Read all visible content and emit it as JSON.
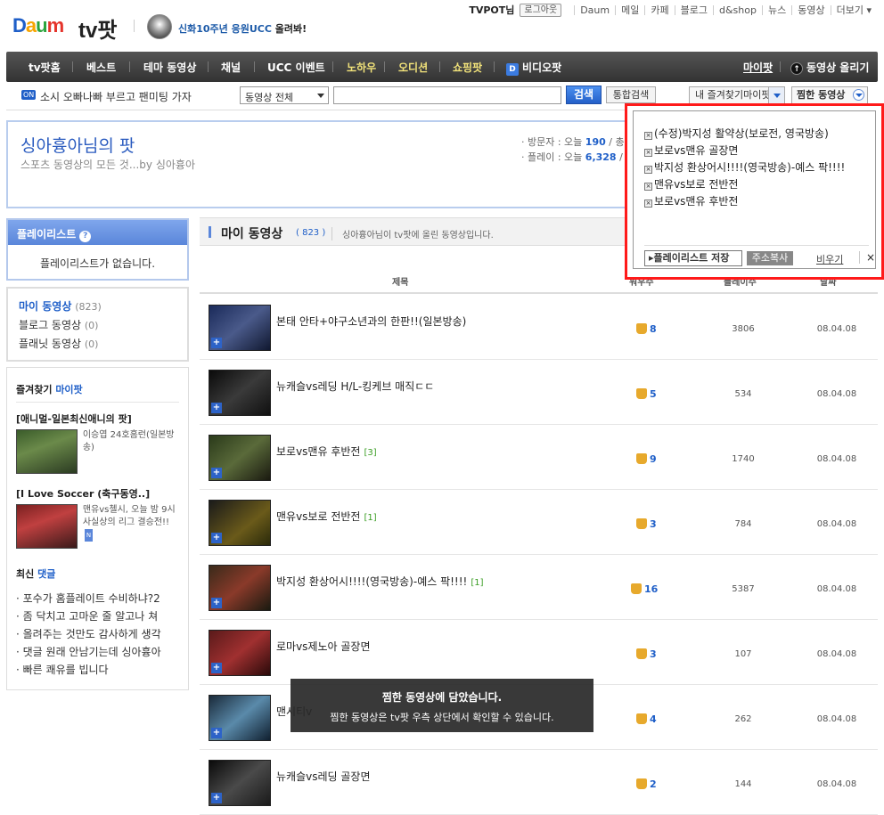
{
  "header": {
    "logo_parts": [
      "D",
      "a",
      "u",
      "m"
    ],
    "service": "tv팟",
    "promo_prefix": "신화10주년 응원UCC",
    "promo_suffix": " 올려봐!",
    "user": "TVPOT님",
    "logout": "로그아웃",
    "links": [
      "Daum",
      "메일",
      "카페",
      "블로그",
      "d&shop",
      "뉴스",
      "동영상",
      "더보기"
    ]
  },
  "nav": {
    "items": [
      "tv팟홈",
      "베스트",
      "테마 동영상",
      "채널",
      "UCC 이벤트",
      "노하우",
      "오디션",
      "쇼핑팟",
      "비디오팟"
    ],
    "mypot": "마이팟",
    "upload": "동영상 올리기"
  },
  "search": {
    "on_badge": "ON",
    "notice": "소시 오빠나빠 부르고 팬미팅 가자",
    "category": "동영상 전체",
    "search_btn": "검색",
    "total_btn": "통합검색",
    "fav_label": "내 즐겨찾기마이팟",
    "saved_label": "찜한 동영상"
  },
  "profile": {
    "name": "싱아흉아님의 팟",
    "desc": "스포츠 동영상의 모든 것...by 싱아흉아",
    "visitors_label": "방문자 : 오늘 ",
    "visitors_today": "190",
    "visitors_suffix": " / 총",
    "play_label": "플레이 : 오늘 ",
    "play_today": "6,328",
    "play_suffix": " / 총"
  },
  "sidebar": {
    "playlist_title": "플레이리스트",
    "playlist_empty": "플레이리스트가 없습니다.",
    "my_videos": "마이 동영상",
    "my_videos_count": "(823)",
    "blog_videos": "블로그 동영상",
    "blog_videos_count": "(0)",
    "planet_videos": "플래닛 동영상",
    "planet_videos_count": "(0)",
    "fav_title_prefix": "즐겨찾기 ",
    "fav_title_accent": "마이팟",
    "favs": [
      {
        "title": "[애니멀-일본최신애니의 팟]",
        "desc": "이승엽 24호홈런(일본방송)"
      },
      {
        "title": "[I Love Soccer (축구동영..]",
        "desc": "맨유vs첼시, 오늘 밤 9시 사실상의 리그 결승전!!",
        "badge": "N"
      }
    ],
    "comments_prefix": "최신 ",
    "comments_accent": "댓글",
    "comments": [
      "포수가 홈플레이트 수비하냐?2",
      "좀 닥치고 고마운 줄 알고나 쳐",
      "올려주는 것만도 감사하게 생각",
      "댓글 원래 안남기는데 싱아흉아",
      "빠른 쾌유를 빕니다"
    ]
  },
  "main": {
    "title": "마이 동영상",
    "count": "( 823 )",
    "desc": "싱아흉아님이 tv팟에 올린 동영상입니다.",
    "columns": [
      "제목",
      "워우수",
      "플레이수",
      "날짜"
    ],
    "videos": [
      {
        "title": "본태 안타+야구소년과의 한판!!(일본방송)",
        "tag": "",
        "likes": "8",
        "plays": "3806",
        "date": "08.04.08"
      },
      {
        "title": "뉴캐슬vs레딩 H/L-킹케브 매직ㄷㄷ",
        "tag": "",
        "likes": "5",
        "plays": "534",
        "date": "08.04.08"
      },
      {
        "title": "보로vs맨유 후반전",
        "tag": "[3]",
        "likes": "9",
        "plays": "1740",
        "date": "08.04.08"
      },
      {
        "title": "맨유vs보로 전반전",
        "tag": "[1]",
        "likes": "3",
        "plays": "784",
        "date": "08.04.08"
      },
      {
        "title": "박지성 환상어시!!!!(영국방송)-예스 팍!!!!",
        "tag": "[1]",
        "likes": "16",
        "plays": "5387",
        "date": "08.04.08"
      },
      {
        "title": "로마vs제노아 골장면",
        "tag": "",
        "likes": "3",
        "plays": "107",
        "date": "08.04.08"
      },
      {
        "title": "맨시티v",
        "tag": "",
        "likes": "4",
        "plays": "262",
        "date": "08.04.08"
      },
      {
        "title": "뉴캐슬vs레딩 골장면",
        "tag": "",
        "likes": "2",
        "plays": "144",
        "date": "08.04.08"
      }
    ]
  },
  "popup": {
    "items": [
      "(수정)박지성 활약상(보로전, 영국방송)",
      "보로vs맨유 골장면",
      "박지성 환상어시!!!!(영국방송)-예스 팍!!!!",
      "맨유vs보로 전반전",
      "보로vs맨유 후반전"
    ],
    "save": "플레이리스트 저장",
    "copy": "주소복사",
    "clear": "비우기",
    "close": "×"
  },
  "toast": {
    "line1": "찜한 동영상에 담았습니다.",
    "line2": "찜한 동영상은 tv팟 우측 상단에서 확인할 수 있습니다."
  }
}
